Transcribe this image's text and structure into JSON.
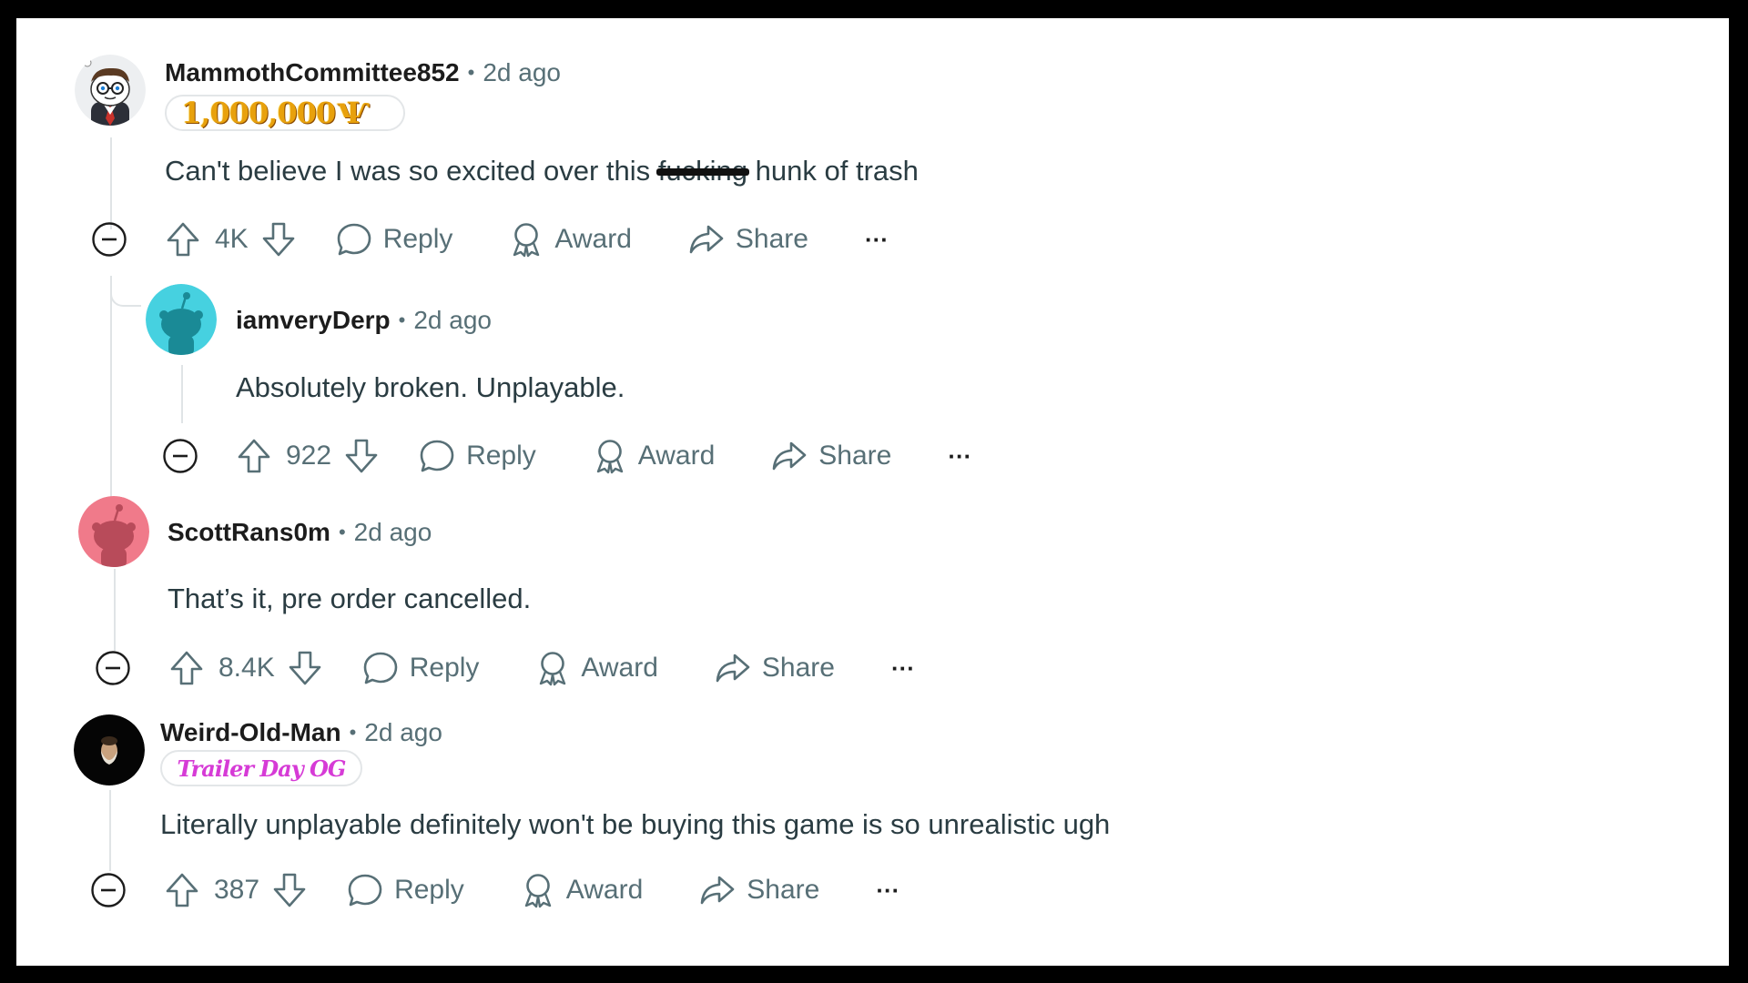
{
  "comments": [
    {
      "username": "MammothCommittee852",
      "sep": "•",
      "time": "2d ago",
      "flair": "1,000,000",
      "flair_suffix": "Ѱ",
      "text_before": "Can't believe I was so excited over this",
      "text_censored": "fucking",
      "text_after": "hunk of trash",
      "score": "4K",
      "avatar": "snoo-glasses-suit-avatar"
    },
    {
      "username": "iamveryDerp",
      "sep": "•",
      "time": "2d ago",
      "text": "Absolutely broken. Unplayable.",
      "score": "922",
      "avatar": "snoo-teal-default-avatar"
    },
    {
      "username": "ScottRans0m",
      "sep": "•",
      "time": "2d ago",
      "text": "That’s it, pre order cancelled.",
      "score": "8.4K",
      "avatar": "snoo-pink-default-avatar"
    },
    {
      "username": "Weird-Old-Man",
      "sep": "•",
      "time": "2d ago",
      "flair": "Trailer Day OG",
      "text": "Literally unplayable definitely won't be buying this game is so unrealistic ugh",
      "score": "387",
      "avatar": "old-man-photo-avatar"
    }
  ],
  "actions": {
    "reply": "Reply",
    "award": "Award",
    "share": "Share",
    "more": "···"
  },
  "colors": {
    "page_bg": "#000000",
    "panel_bg": "#ffffff",
    "meta": "#576f76",
    "body_text": "#2a3c42",
    "thread_line": "#e0e4e6",
    "gold_flair": "#e8a10c",
    "pink_flair": "#d63bd6",
    "teal_avatar": "#46d1e0",
    "pink_avatar": "#f07a8a"
  }
}
